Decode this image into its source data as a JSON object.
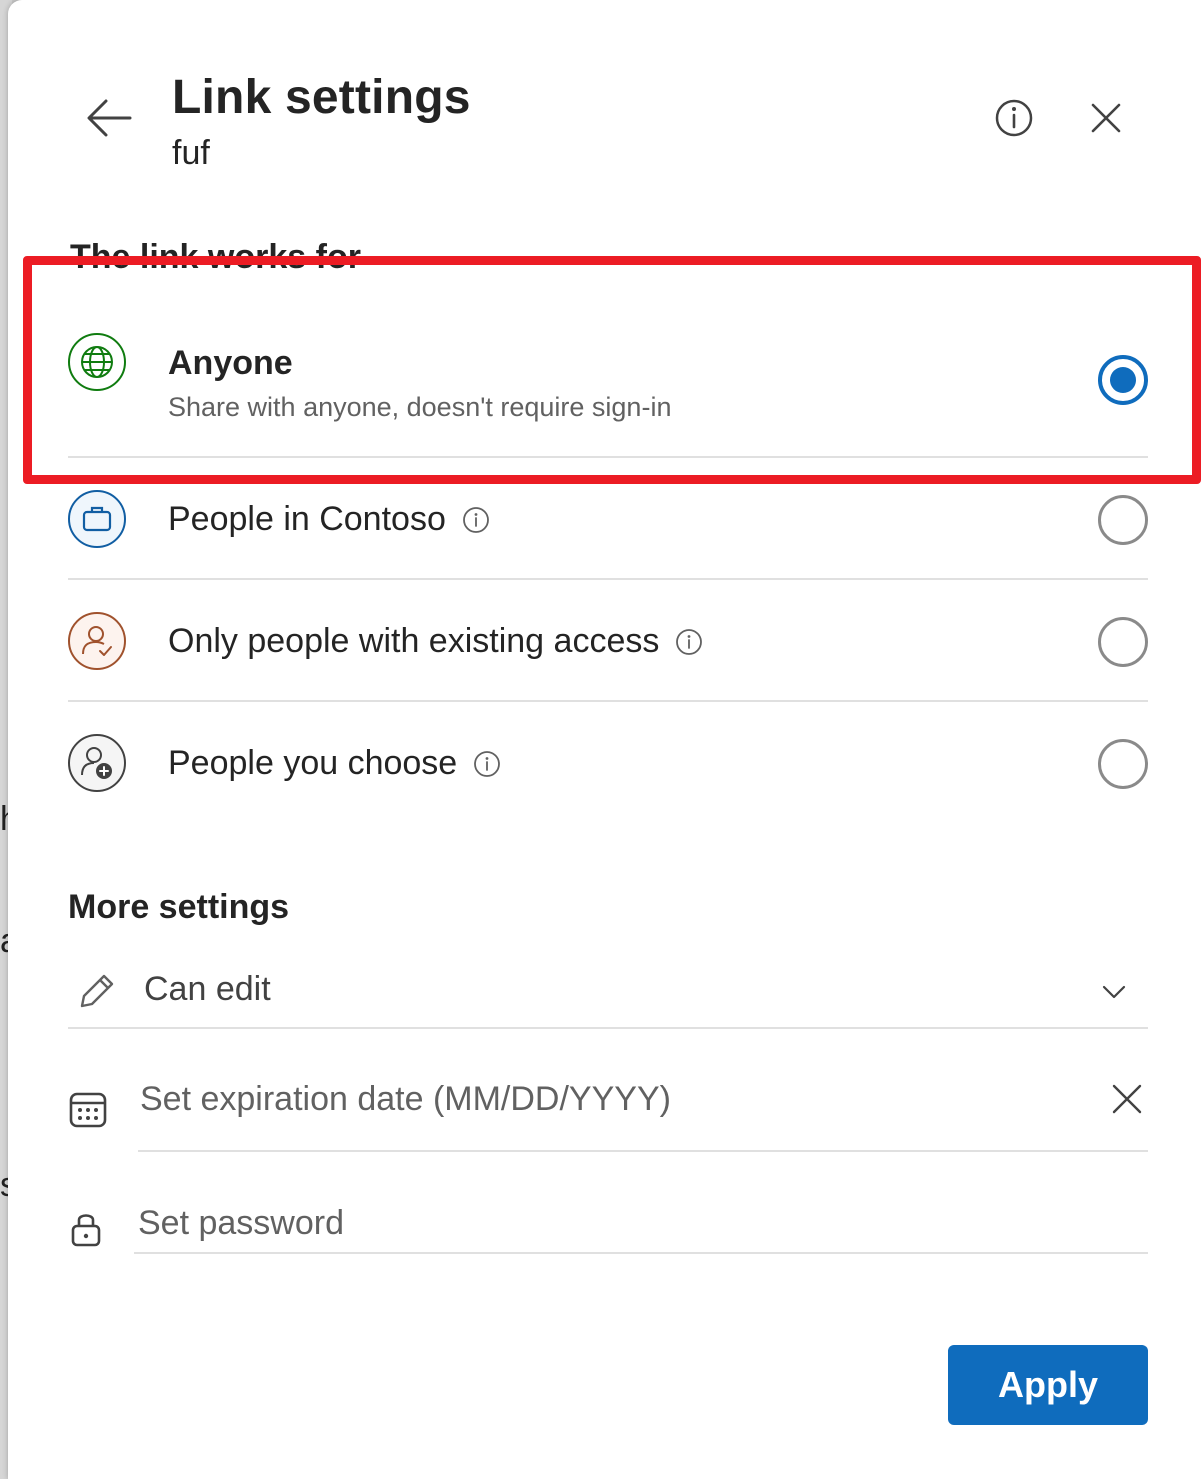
{
  "background": {
    "fragments": [
      "h",
      "a",
      "s"
    ]
  },
  "header": {
    "title": "Link settings",
    "subtitle": "fuf",
    "back_icon": "arrow-left-icon",
    "info_icon": "info-icon",
    "close_icon": "close-icon"
  },
  "audience": {
    "heading": "The link works for",
    "options": [
      {
        "label": "Anyone",
        "description": "Share with anyone, doesn't require sign-in",
        "icon": "globe-icon",
        "selected": true,
        "has_info": false
      },
      {
        "label": "People in Contoso",
        "description": "",
        "icon": "briefcase-icon",
        "selected": false,
        "has_info": true
      },
      {
        "label": "Only people with existing access",
        "description": "",
        "icon": "person-check-icon",
        "selected": false,
        "has_info": true
      },
      {
        "label": "People you choose",
        "description": "",
        "icon": "person-add-icon",
        "selected": false,
        "has_info": true
      }
    ]
  },
  "more_settings": {
    "heading": "More settings",
    "permission": {
      "label": "Can edit",
      "icon": "pencil-icon"
    },
    "expiration": {
      "placeholder": "Set expiration date (MM/DD/YYYY)",
      "icon": "calendar-icon"
    },
    "password": {
      "placeholder": "Set password",
      "icon": "lock-icon"
    }
  },
  "footer": {
    "apply_label": "Apply"
  },
  "colors": {
    "accent": "#0f6cbd",
    "highlight_border": "#ec1c24",
    "globe": "#107c10",
    "briefcase": "#115ea3",
    "person_check": "#a0522d",
    "person_add": "#424242"
  }
}
